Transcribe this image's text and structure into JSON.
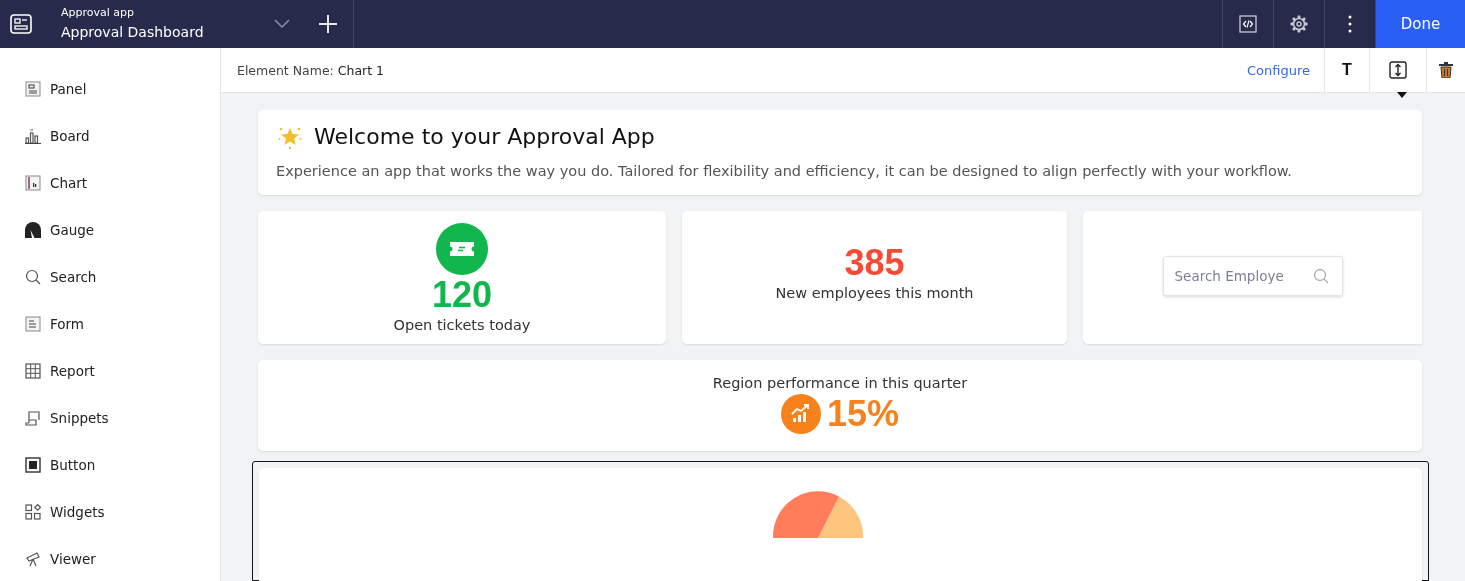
{
  "header": {
    "app_name": "Approval app",
    "page_title": "Approval Dashboard",
    "done_button": "Done"
  },
  "sidebar": {
    "items": [
      {
        "label": "Panel"
      },
      {
        "label": "Board"
      },
      {
        "label": "Chart"
      },
      {
        "label": "Gauge"
      },
      {
        "label": "Search"
      },
      {
        "label": "Form"
      },
      {
        "label": "Report"
      },
      {
        "label": "Snippets"
      },
      {
        "label": "Button"
      },
      {
        "label": "Widgets"
      },
      {
        "label": "Viewer"
      }
    ]
  },
  "element_bar": {
    "label": "Element Name:",
    "value": "Chart 1",
    "configure_link": "Configure",
    "text_tool": "T"
  },
  "welcome": {
    "title": "Welcome to your Approval App",
    "description": "Experience an app that works the way you do. Tailored for flexibility and efficiency, it can be designed to align perfectly with your workflow."
  },
  "stats": [
    {
      "value": "120",
      "label": "Open tickets today",
      "color": "#12b64f"
    },
    {
      "value": "385",
      "label": "New employees this month",
      "color": "#f54b35"
    }
  ],
  "search": {
    "placeholder": "Search Employe"
  },
  "region": {
    "label": "Region performance in this quarter",
    "value": "15%",
    "color": "#f7821b"
  },
  "chart_panel": {
    "selected": true
  }
}
